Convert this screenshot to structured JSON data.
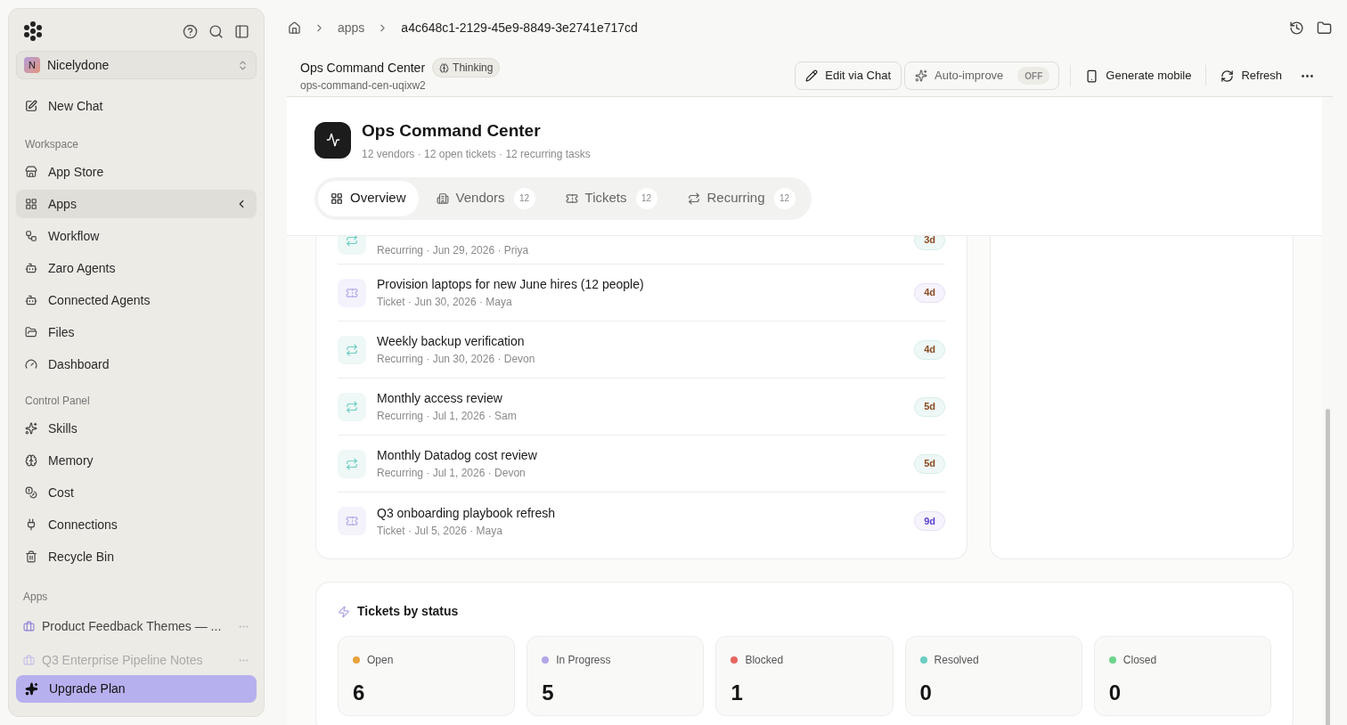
{
  "sidebar": {
    "workspace": {
      "initial": "N",
      "name": "Nicelydone"
    },
    "new_chat": "New Chat",
    "sections": [
      {
        "title": "Workspace",
        "items": [
          {
            "label": "App Store",
            "selected": false
          },
          {
            "label": "Apps",
            "selected": true
          },
          {
            "label": "Workflow",
            "selected": false
          },
          {
            "label": "Zaro Agents",
            "selected": false
          },
          {
            "label": "Connected Agents",
            "selected": false
          },
          {
            "label": "Files",
            "selected": false
          },
          {
            "label": "Dashboard",
            "selected": false
          }
        ]
      },
      {
        "title": "Control Panel",
        "items": [
          {
            "label": "Skills",
            "selected": false
          },
          {
            "label": "Memory",
            "selected": false
          },
          {
            "label": "Cost",
            "selected": false
          },
          {
            "label": "Connections",
            "selected": false
          },
          {
            "label": "Recycle Bin",
            "selected": false
          }
        ]
      }
    ],
    "apps_title": "Apps",
    "apps": [
      {
        "label": "Product Feedback Themes — ...",
        "faded": false
      },
      {
        "label": "Q3 Enterprise Pipeline Notes",
        "faded": true
      }
    ],
    "upgrade": "Upgrade Plan"
  },
  "breadcrumb": [
    "apps",
    "a4c648c1-2129-45e9-8849-3e2741e717cd"
  ],
  "app_header": {
    "title": "Ops Command Center",
    "badge": "Thinking",
    "slug": "ops-command-cen-uqixw2",
    "actions": {
      "edit": "Edit via Chat",
      "auto_improve": {
        "label": "Auto-improve",
        "state": "OFF",
        "on": false
      },
      "mobile": "Generate mobile",
      "refresh": "Refresh"
    }
  },
  "app": {
    "title": "Ops Command Center",
    "subtitle": "12 vendors · 12 open tickets · 12 recurring tasks",
    "tabs": [
      {
        "label": "Overview",
        "selected": true
      },
      {
        "label": "Vendors",
        "count": "12",
        "selected": false
      },
      {
        "label": "Tickets",
        "count": "12",
        "selected": false
      },
      {
        "label": "Recurring",
        "count": "12",
        "selected": false
      }
    ]
  },
  "list": [
    {
      "kind": "recurring",
      "meta": "Recurring · Jun 29, 2026 · Priya",
      "due": "3d",
      "urgent": true
    },
    {
      "kind": "ticket",
      "title": "Provision laptops for new June hires (12 people)",
      "meta": "Ticket · Jun 30, 2026 · Maya",
      "due": "4d",
      "urgent": true
    },
    {
      "kind": "recurring",
      "title": "Weekly backup verification",
      "meta": "Recurring · Jun 30, 2026 · Devon",
      "due": "4d",
      "urgent": true
    },
    {
      "kind": "recurring",
      "title": "Monthly access review",
      "meta": "Recurring · Jul 1, 2026 · Sam",
      "due": "5d",
      "urgent": true
    },
    {
      "kind": "recurring",
      "title": "Monthly Datadog cost review",
      "meta": "Recurring · Jul 1, 2026 · Devon",
      "due": "5d",
      "urgent": true
    },
    {
      "kind": "ticket",
      "title": "Q3 onboarding playbook refresh",
      "meta": "Ticket · Jul 5, 2026 · Maya",
      "due": "9d",
      "urgent": false
    }
  ],
  "status": {
    "title": "Tickets by status",
    "items": [
      {
        "label": "Open",
        "value": "6",
        "color": "#e8a23a"
      },
      {
        "label": "In Progress",
        "value": "5",
        "color": "#b3a6e6"
      },
      {
        "label": "Blocked",
        "value": "1",
        "color": "#e5675f"
      },
      {
        "label": "Resolved",
        "value": "0",
        "color": "#6ccdc3"
      },
      {
        "label": "Closed",
        "value": "0",
        "color": "#6dd58c"
      }
    ]
  }
}
